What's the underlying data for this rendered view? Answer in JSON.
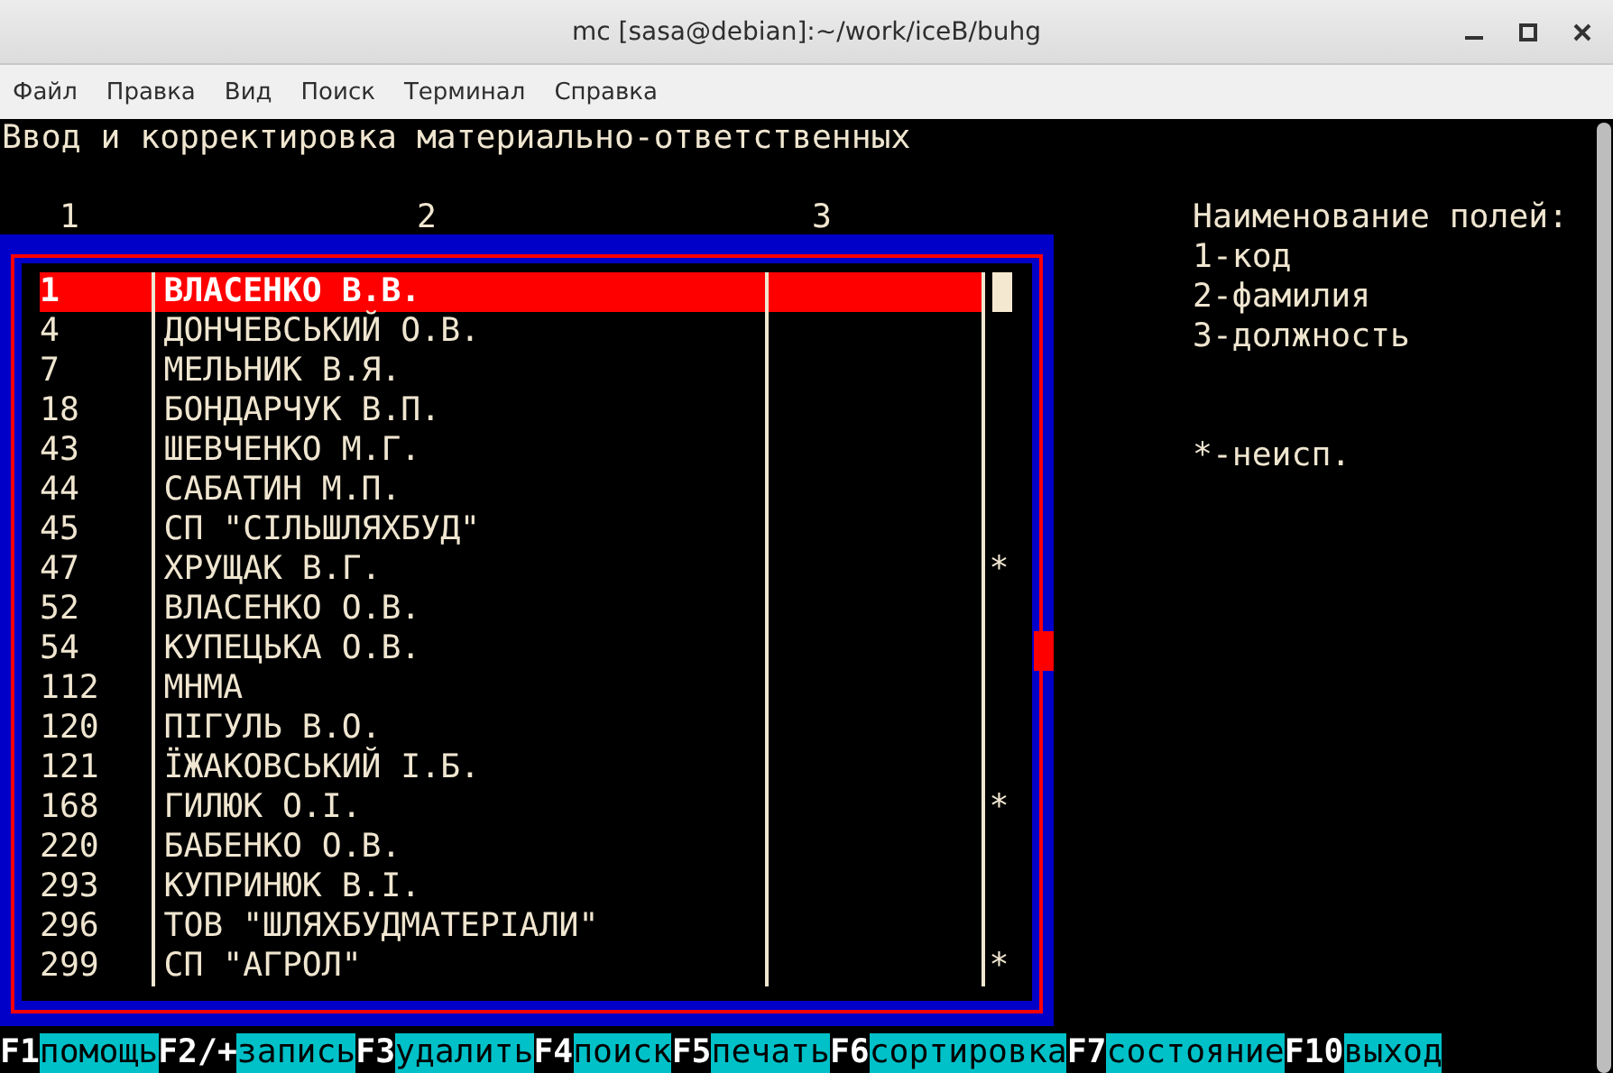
{
  "window": {
    "title": "mc [sasa@debian]:~/work/iceB/buhg"
  },
  "menu": [
    "Файл",
    "Правка",
    "Вид",
    "Поиск",
    "Терминал",
    "Справка"
  ],
  "terminal": {
    "heading": "Ввод и корректировка материально-ответственных",
    "column_numbers": [
      "1",
      "2",
      "3"
    ],
    "table": {
      "rows": [
        {
          "code": "1",
          "name": "ВЛАСЕНКО В.В.",
          "selected": true
        },
        {
          "code": "4",
          "name": "ДОНЧЕВСЬКИЙ О.В.",
          "selected": false
        },
        {
          "code": "7",
          "name": "МЕЛЬНИК В.Я.",
          "selected": false
        },
        {
          "code": "18",
          "name": "БОНДАРЧУК В.П.",
          "selected": false
        },
        {
          "code": "43",
          "name": "ШЕВЧЕНКО М.Г.",
          "selected": false
        },
        {
          "code": "44",
          "name": "САБАТИН М.П.",
          "selected": false
        },
        {
          "code": "45",
          "name": "СП \"СІЛЬШЛЯХБУД\"",
          "selected": false
        },
        {
          "code": "47",
          "name": "ХРУЩАК В.Г.",
          "flag": "*",
          "selected": false
        },
        {
          "code": "52",
          "name": "ВЛАСЕНКО О.В.",
          "selected": false
        },
        {
          "code": "54",
          "name": "КУПЕЦЬКА О.В.",
          "selected": false
        },
        {
          "code": "112",
          "name": "МНМА",
          "selected": false
        },
        {
          "code": "120",
          "name": "ПІГУЛЬ В.О.",
          "selected": false
        },
        {
          "code": "121",
          "name": "ЇЖАКОВСЬКИЙ І.Б.",
          "selected": false
        },
        {
          "code": "168",
          "name": "ГИЛЮК О.І.",
          "flag": "*",
          "selected": false
        },
        {
          "code": "220",
          "name": "БАБЕНКО О.В.",
          "selected": false
        },
        {
          "code": "293",
          "name": "КУПРИНЮК В.І.",
          "selected": false
        },
        {
          "code": "296",
          "name": "ТОВ \"ШЛЯХБУДМАТЕРІАЛИ\"",
          "selected": false
        },
        {
          "code": "299",
          "name": "СП \"АГРОЛ\"",
          "flag": "*",
          "selected": false
        }
      ]
    },
    "legend": {
      "title": "Наименование полей:",
      "lines": [
        "1-код",
        "2-фамилия",
        "3-должность"
      ],
      "note": "*-неисп."
    },
    "function_keys": [
      {
        "key": "F1",
        "label": "помощь"
      },
      {
        "key": "F2/+",
        "label": "запись"
      },
      {
        "key": "F3",
        "label": "удалить"
      },
      {
        "key": "F4",
        "label": "поиск"
      },
      {
        "key": "F5",
        "label": "печать"
      },
      {
        "key": "F6",
        "label": "сортировка"
      },
      {
        "key": "F7",
        "label": "состояние"
      },
      {
        "key": "F10",
        "label": "выход"
      }
    ]
  }
}
